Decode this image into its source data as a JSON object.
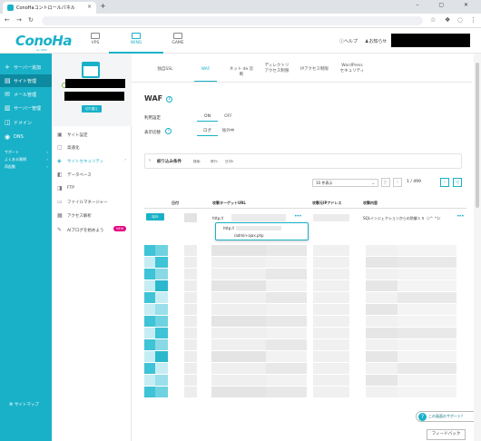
{
  "browser": {
    "tab_title": "ConoHaコントロールパネル",
    "close_label": "×",
    "new_tab_label": "+",
    "window_controls": "– ▢ ✕"
  },
  "header": {
    "logo_text": "ConoHa",
    "logo_sub": "by GMO",
    "tabs": [
      {
        "label": "VPS",
        "active": false
      },
      {
        "label": "WING",
        "active": true
      },
      {
        "label": "GAME",
        "active": false
      }
    ],
    "help_label": "ヘルプ",
    "notice_label": "お知らせ"
  },
  "sidenav": {
    "items": [
      {
        "label": "サーバー追加",
        "icon": "+"
      },
      {
        "label": "サイト管理",
        "icon": "▤",
        "active": true
      },
      {
        "label": "メール管理",
        "icon": "✉"
      },
      {
        "label": "サーバー管理",
        "icon": "▥"
      },
      {
        "label": "ドメイン",
        "icon": "◫"
      },
      {
        "label": "DNS",
        "icon": "◉"
      }
    ],
    "sub_items": [
      "サポート",
      "よくある質問",
      "再起動"
    ],
    "sitemap_label": "サイトマップ"
  },
  "site_panel": {
    "button_label": "切り替え",
    "items": [
      {
        "label": "サイト設定",
        "icon": "▣"
      },
      {
        "label": "高速化",
        "icon": "▢"
      },
      {
        "label": "サイトセキュリティ",
        "icon": "◈",
        "active": true
      },
      {
        "label": "データベース",
        "icon": "◧"
      },
      {
        "label": "FTP",
        "icon": "◨"
      },
      {
        "label": "ファイルマネージャー",
        "icon": "▭"
      },
      {
        "label": "アクセス解析",
        "icon": "▦"
      },
      {
        "label": "AIブログを始めよう",
        "icon": "✎",
        "badge": "NEW"
      }
    ]
  },
  "content": {
    "tabs": [
      {
        "label": "独自SSL",
        "active": false
      },
      {
        "label": "WAF",
        "active": true
      },
      {
        "label": "ネット de 診断",
        "active": false
      },
      {
        "label": "ディレクトリ\nアクセス制限",
        "active": false
      },
      {
        "label": "IPアクセス制限",
        "active": false
      },
      {
        "label": "WordPress\nセキュリティ",
        "active": false
      }
    ],
    "title": "WAF",
    "settings": {
      "usage_label": "利用設定",
      "usage_on": "ON",
      "usage_off": "OFF",
      "display_label": "表示切替",
      "display_log": "ログ",
      "display_exclude": "除外中"
    },
    "filter": {
      "label": "絞り込み条件",
      "f1": "検索：",
      "f2": "修行：",
      "f3": "日付▾"
    },
    "pagination": {
      "per_page": "10 件表示",
      "page": "1",
      "total": "499",
      "separator": "/"
    },
    "table": {
      "headers": [
        "日付",
        "攻撃ターゲットURL",
        "攻撃元IPアドレス",
        "攻撃内容"
      ],
      "row1": {
        "button": "除外",
        "url": "http://",
        "content": "SQLインジェクションからの防御１５（ﾉ^ ^)ﾉ"
      },
      "popup": {
        "line1": "http://",
        "line2": "/admin-ajax.php"
      }
    },
    "assist_label": "この画面のサポート？",
    "feedback_label": "フィードバック"
  },
  "colors": {
    "accent": "#19b1c8",
    "accent_dark": "#0d8aa0",
    "badge": "#e4007f"
  }
}
